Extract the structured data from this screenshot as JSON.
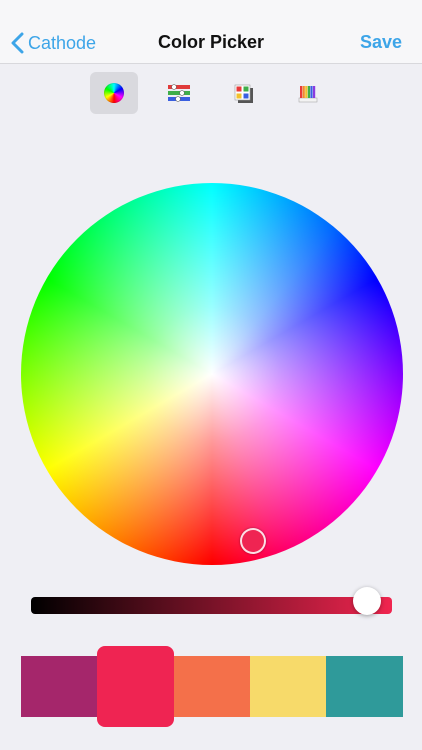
{
  "navbar": {
    "back_label": "Cathode",
    "title": "Color Picker",
    "save_label": "Save"
  },
  "modes": [
    {
      "name": "color-wheel",
      "active": true
    },
    {
      "name": "sliders",
      "active": false
    },
    {
      "name": "swatches-grid",
      "active": false
    },
    {
      "name": "crayons",
      "active": false
    }
  ],
  "picker": {
    "selected_color": "#ef2452",
    "brightness_fraction": 0.93,
    "slider_start_color": "#000000",
    "slider_end_color": "#f0254f"
  },
  "palette": [
    {
      "color": "#a5266b",
      "selected": false
    },
    {
      "color": "#ef2452",
      "selected": true
    },
    {
      "color": "#f4704a",
      "selected": false
    },
    {
      "color": "#f7da6a",
      "selected": false
    },
    {
      "color": "#2f9a9a",
      "selected": false
    }
  ],
  "colors": {
    "accent": "#3da5e8"
  }
}
